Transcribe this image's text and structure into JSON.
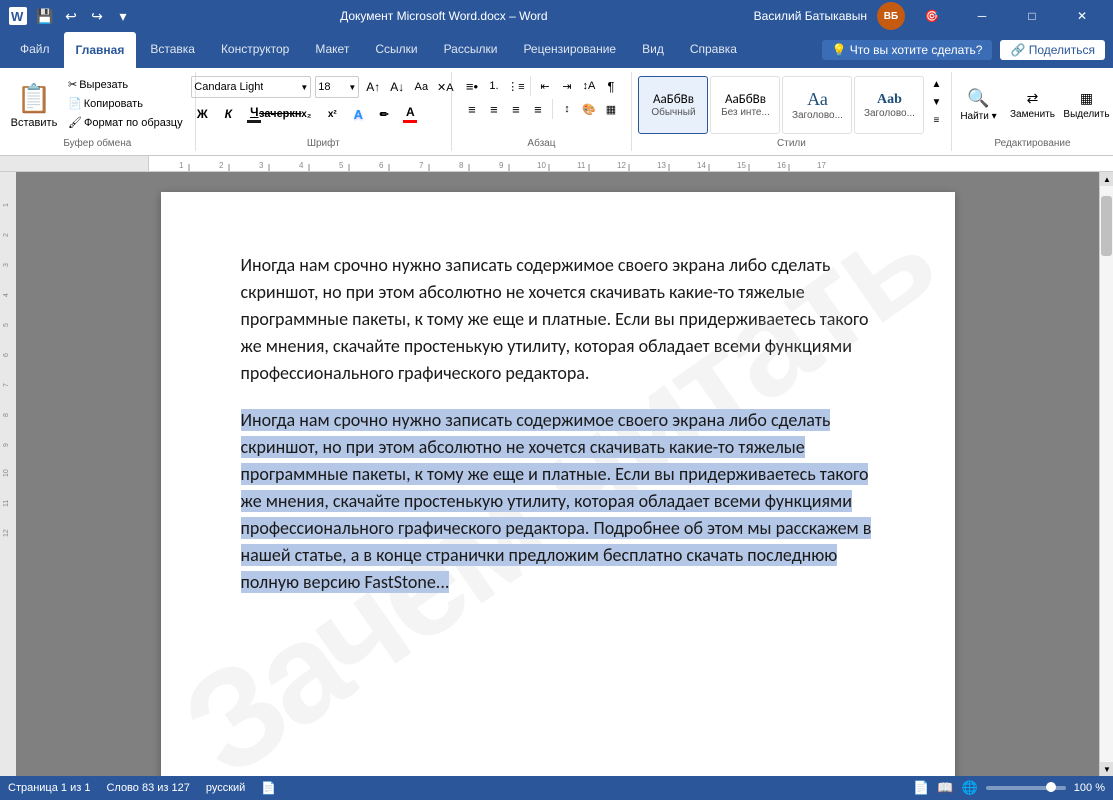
{
  "titleBar": {
    "title": "Документ Microsoft Word.docx  –  Word",
    "userName": "Василий Батыкавын",
    "userInitials": "ВБ",
    "minBtn": "─",
    "maxBtn": "□",
    "closeBtn": "✕"
  },
  "ribbon": {
    "tabs": [
      {
        "label": "Файл",
        "active": false
      },
      {
        "label": "Главная",
        "active": true
      },
      {
        "label": "Вставка",
        "active": false
      },
      {
        "label": "Конструктор",
        "active": false
      },
      {
        "label": "Макет",
        "active": false
      },
      {
        "label": "Ссылки",
        "active": false
      },
      {
        "label": "Рассылки",
        "active": false
      },
      {
        "label": "Рецензирование",
        "active": false
      },
      {
        "label": "Вид",
        "active": false
      },
      {
        "label": "Справка",
        "active": false
      }
    ],
    "lightbulb": "💡 Что вы хотите сделать?",
    "shareBtn": "🔗 Поделиться",
    "groups": {
      "clipboard": {
        "label": "Буфер обмена",
        "pasteLabel": "Вставить",
        "cut": "Вырезать",
        "copy": "Копировать",
        "formatPainter": "Формат по образцу"
      },
      "font": {
        "label": "Шрифт",
        "fontName": "Candara Light",
        "fontSize": "18",
        "bold": "Ж",
        "italic": "К",
        "underline": "Ч",
        "strikethrough": "зачеркн.",
        "subscript": "x₂",
        "superscript": "x²"
      },
      "paragraph": {
        "label": "Абзац"
      },
      "styles": {
        "label": "Стили",
        "items": [
          {
            "name": "Обычный",
            "preview": "АаБбВв",
            "active": true
          },
          {
            "name": "Без инте...",
            "preview": "АаБбВв"
          },
          {
            "name": "Заголово...",
            "preview": "Аа"
          },
          {
            "name": "Заголово...",
            "preview": "Аab"
          }
        ]
      },
      "editing": {
        "label": "Редактирование",
        "find": "Найти",
        "replace": "Заменить",
        "select": "Выделить"
      }
    }
  },
  "document": {
    "paragraph1": "Иногда нам срочно нужно записать содержимое своего экрана либо сделать скриншот, но при этом абсолютно не хочется скачивать какие-то тяжелые программные пакеты, к тому же еще и платные. Если вы придерживаетесь такого же мнения, скачайте простенькую утилиту, которая обладает всеми функциями профессионального графического редактора.",
    "paragraph2selected": "Иногда нам срочно нужно записать содержимое своего экрана либо сделать скриншот, но при этом абсолютно не хочется скачивать какие-то тяжелые программные пакеты, к тому же еще и платные. Если вы придерживаетесь такого же мнения, скачайте простенькую утилиту, которая обладает всеми функциями профессионального графического редактора. Подробнее об этом мы расскажем в нашей статье, а в конце странички предложим бесплатно скачать последнюю полную версию FastStone...",
    "watermark": "Зачем читать"
  },
  "statusBar": {
    "page": "Страница 1 из 1",
    "words": "Слово 83 из 127",
    "language": "русский",
    "zoom": "100 %"
  }
}
